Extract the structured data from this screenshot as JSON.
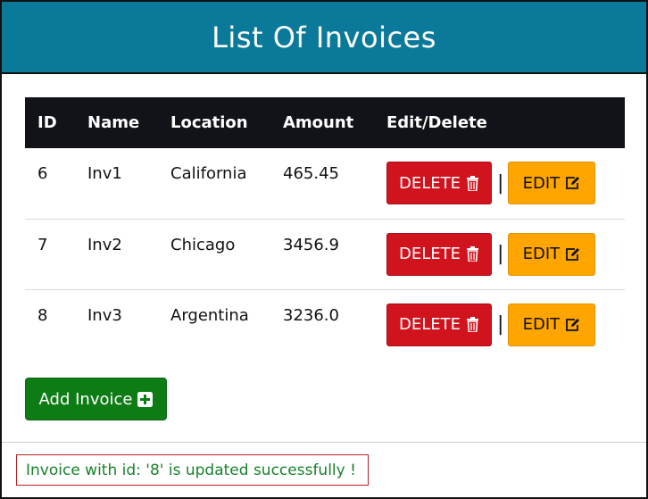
{
  "page": {
    "title": "List Of Invoices"
  },
  "table": {
    "columns": [
      "ID",
      "Name",
      "Location",
      "Amount",
      "Edit/Delete"
    ],
    "rows": [
      {
        "id": "6",
        "name": "Inv1",
        "location": "California",
        "amount": "465.45"
      },
      {
        "id": "7",
        "name": "Inv2",
        "location": "Chicago",
        "amount": "3456.9"
      },
      {
        "id": "8",
        "name": "Inv3",
        "location": "Argentina",
        "amount": "3236.0"
      }
    ],
    "delete_label": "DELETE",
    "edit_label": "EDIT",
    "separator": "|"
  },
  "add_button": {
    "label": "Add Invoice"
  },
  "status": {
    "message": "Invoice with id: '8' is updated successfully !"
  },
  "icons": {
    "delete": "trash-icon",
    "edit": "edit-pencil-square-icon",
    "add": "plus-square-icon"
  },
  "colors": {
    "header_bg": "#0b7a9a",
    "table_header_bg": "#111318",
    "delete_bg": "#d1131e",
    "edit_bg": "#ffa500",
    "add_bg": "#0e7c15",
    "status_text": "#17822a",
    "status_border": "#b02323"
  }
}
